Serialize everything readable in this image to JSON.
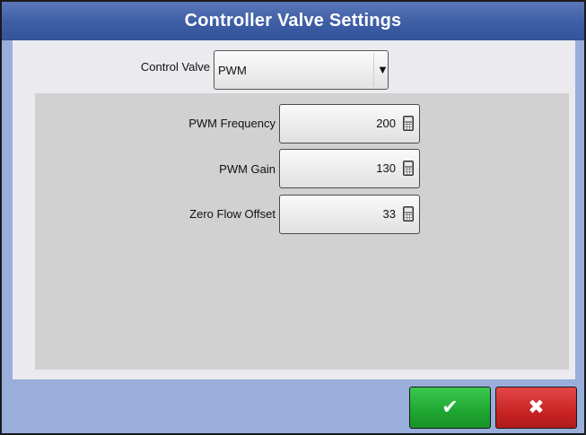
{
  "dialog": {
    "title": "Controller Valve Settings"
  },
  "control_valve": {
    "label": "Control Valve",
    "value": "PWM",
    "arrow": "▼"
  },
  "settings": [
    {
      "label": "PWM Frequency",
      "value": "200",
      "icon": "calculator-icon"
    },
    {
      "label": "PWM Gain",
      "value": "130",
      "icon": "calculator-icon"
    },
    {
      "label": "Zero Flow Offset",
      "value": "33",
      "icon": "calculator-icon"
    }
  ],
  "buttons": {
    "ok_glyph": "✔",
    "cancel_glyph": "✖",
    "ok_color": "#1fa632",
    "cancel_color": "#c92424"
  },
  "colors": {
    "title_bar": "#3d5da4",
    "frame": "#99aedb",
    "panel": "#eaeaef",
    "inner_panel": "#d1d1d1"
  }
}
